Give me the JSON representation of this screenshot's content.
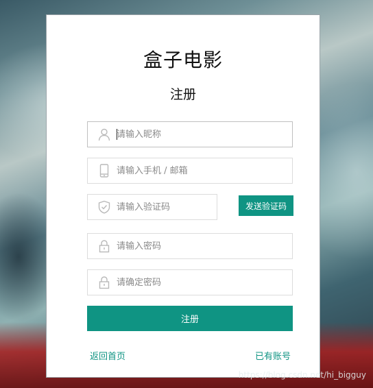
{
  "app": {
    "title": "盒子电影",
    "subtitle": "注册"
  },
  "form": {
    "nickname_placeholder": "请输入昵称",
    "contact_placeholder": "请输入手机 / 邮箱",
    "code_placeholder": "请输入验证码",
    "send_code_label": "发送验证码",
    "password_placeholder": "请输入密码",
    "confirm_password_placeholder": "请确定密码",
    "submit_label": "注册"
  },
  "links": {
    "back_home": "返回首页",
    "has_account": "已有账号"
  },
  "watermark": "https://blog.csdn.net/hi_bigguy",
  "colors": {
    "accent": "#0f9483",
    "icon": "#b9b9b9"
  },
  "icons": {
    "nickname": "user-icon",
    "contact": "phone-icon",
    "code": "shield-check-icon",
    "password": "lock-icon",
    "confirm_password": "lock-icon"
  }
}
